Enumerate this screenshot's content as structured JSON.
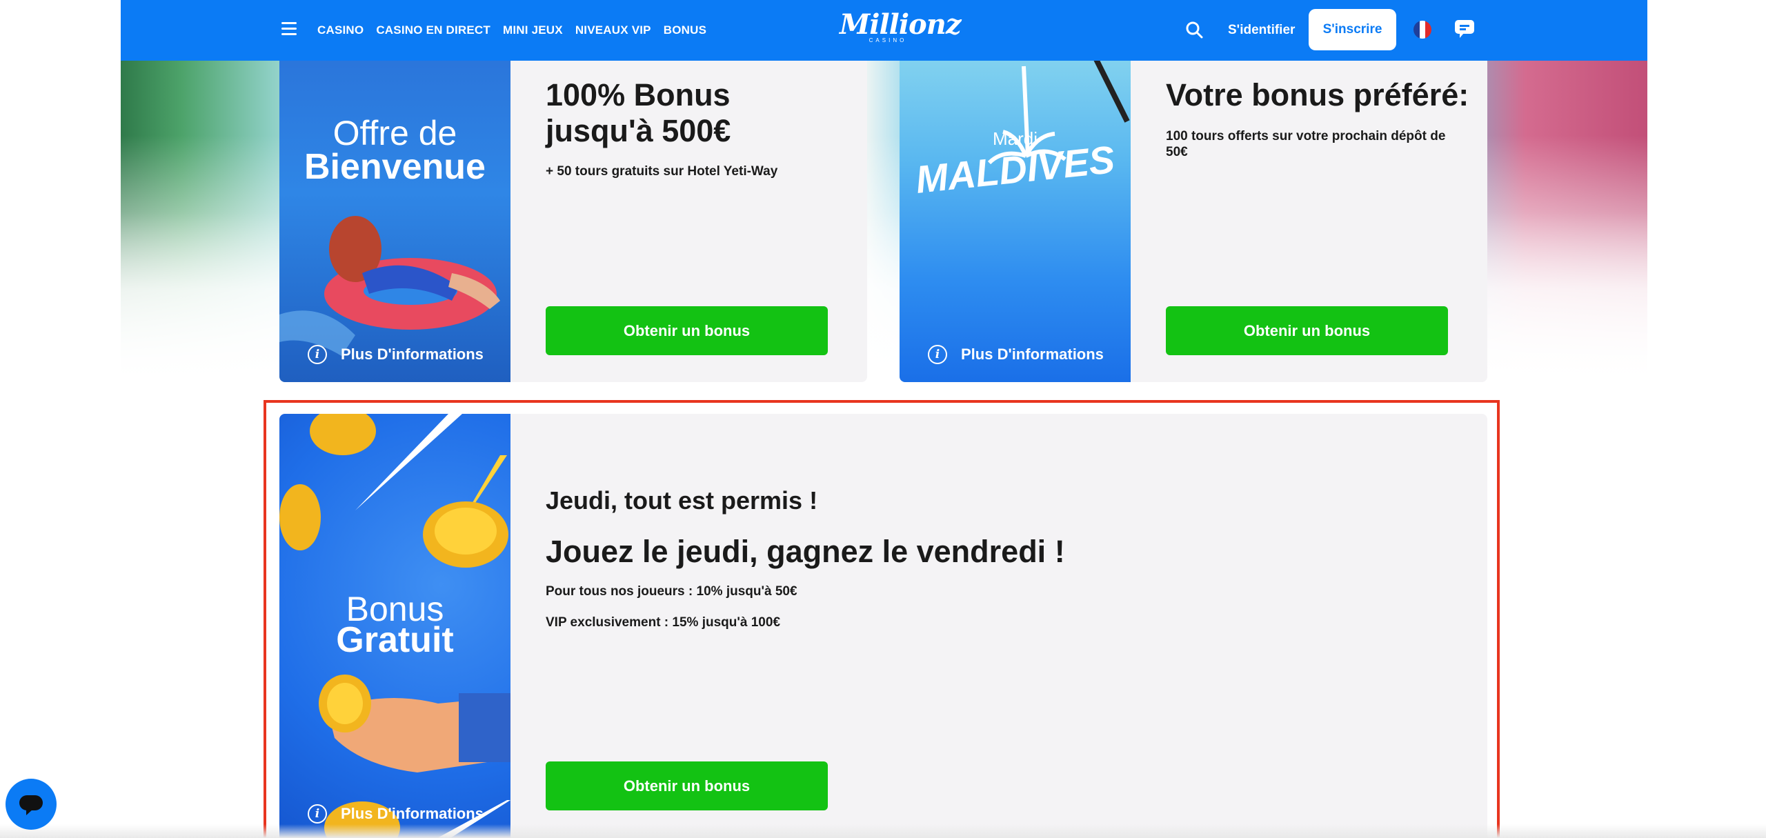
{
  "header": {
    "nav": [
      "CASINO",
      "CASINO EN DIRECT",
      "MINI JEUX",
      "NIVEAUX VIP",
      "BONUS"
    ],
    "logo": "Millionz",
    "logo_sub": "CASINO",
    "login": "S'identifier",
    "signup": "S'inscrire",
    "brand_color": "#0b7bf5"
  },
  "cards": [
    {
      "image_line1": "Offre de",
      "image_line2": "Bienvenue",
      "more_info": "Plus D'informations",
      "title": "100% Bonus jusqu'à 500€",
      "subtitle": "+ 50 tours gratuits sur Hotel Yeti-Way",
      "button": "Obtenir un bonus"
    },
    {
      "image_line1": "Mardi",
      "image_line2": "MALDIVES",
      "more_info": "Plus D'informations",
      "title": "Votre bonus préféré:",
      "subtitle": "100 tours offerts sur votre prochain dépôt de 50€",
      "button": "Obtenir un bonus"
    },
    {
      "image_line1": "Bonus",
      "image_line2": "Gratuit",
      "more_info": "Plus D'informations",
      "title": "Jeudi, tout est permis !",
      "headline": "Jouez le jeudi, gagnez le vendredi !",
      "line1": "Pour tous nos joueurs : 10% jusqu'à 50€",
      "line2": "VIP exclusivement : 15% jusqu'à 100€",
      "button": "Obtenir un bonus"
    }
  ],
  "colors": {
    "cta_green": "#13c213",
    "highlight_red": "#e8351f"
  }
}
